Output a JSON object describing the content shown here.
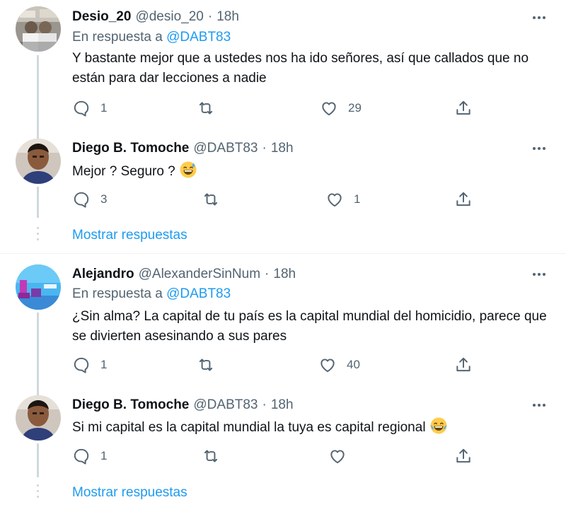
{
  "colors": {
    "accent": "#1d9bf0",
    "secondary_text": "#536471",
    "primary_text": "#0f1419",
    "thread_line": "#cfd9de"
  },
  "tweets": [
    {
      "name": "Desio_20",
      "handle": "@desio_20",
      "dot": "·",
      "time": "18h",
      "reply_prefix": "En respuesta a",
      "reply_to": "@DABT83",
      "text": "Y bastante mejor que a ustedes nos ha ido señores, así que callados que no están para dar lecciones a nadie",
      "replies": "1",
      "retweets": "",
      "likes": "29",
      "avatar_icon": "profile-photo"
    },
    {
      "name": "Diego B. Tomoche",
      "handle": "@DABT83",
      "dot": "·",
      "time": "18h",
      "text": "Mejor ? Seguro ?",
      "emoji": "grinning-sweat-emoji",
      "replies": "3",
      "retweets": "",
      "likes": "1",
      "avatar_icon": "profile-photo"
    },
    {
      "name": "Alejandro",
      "handle": "@AlexanderSinNum",
      "dot": "·",
      "time": "18h",
      "reply_prefix": "En respuesta a",
      "reply_to": "@DABT83",
      "text": "¿Sin alma?  La capital de tu país es la capital mundial del homicidio, parece que se divierten asesinando a sus pares",
      "replies": "1",
      "retweets": "",
      "likes": "40",
      "avatar_icon": "profile-photo"
    },
    {
      "name": "Diego B. Tomoche",
      "handle": "@DABT83",
      "dot": "·",
      "time": "18h",
      "text": "Si mi capital es la capital mundial la tuya es capital regional",
      "emoji": "tears-of-joy-emoji",
      "replies": "1",
      "retweets": "",
      "likes": "",
      "avatar_icon": "profile-photo"
    }
  ],
  "show_replies_label": "Mostrar respuestas"
}
